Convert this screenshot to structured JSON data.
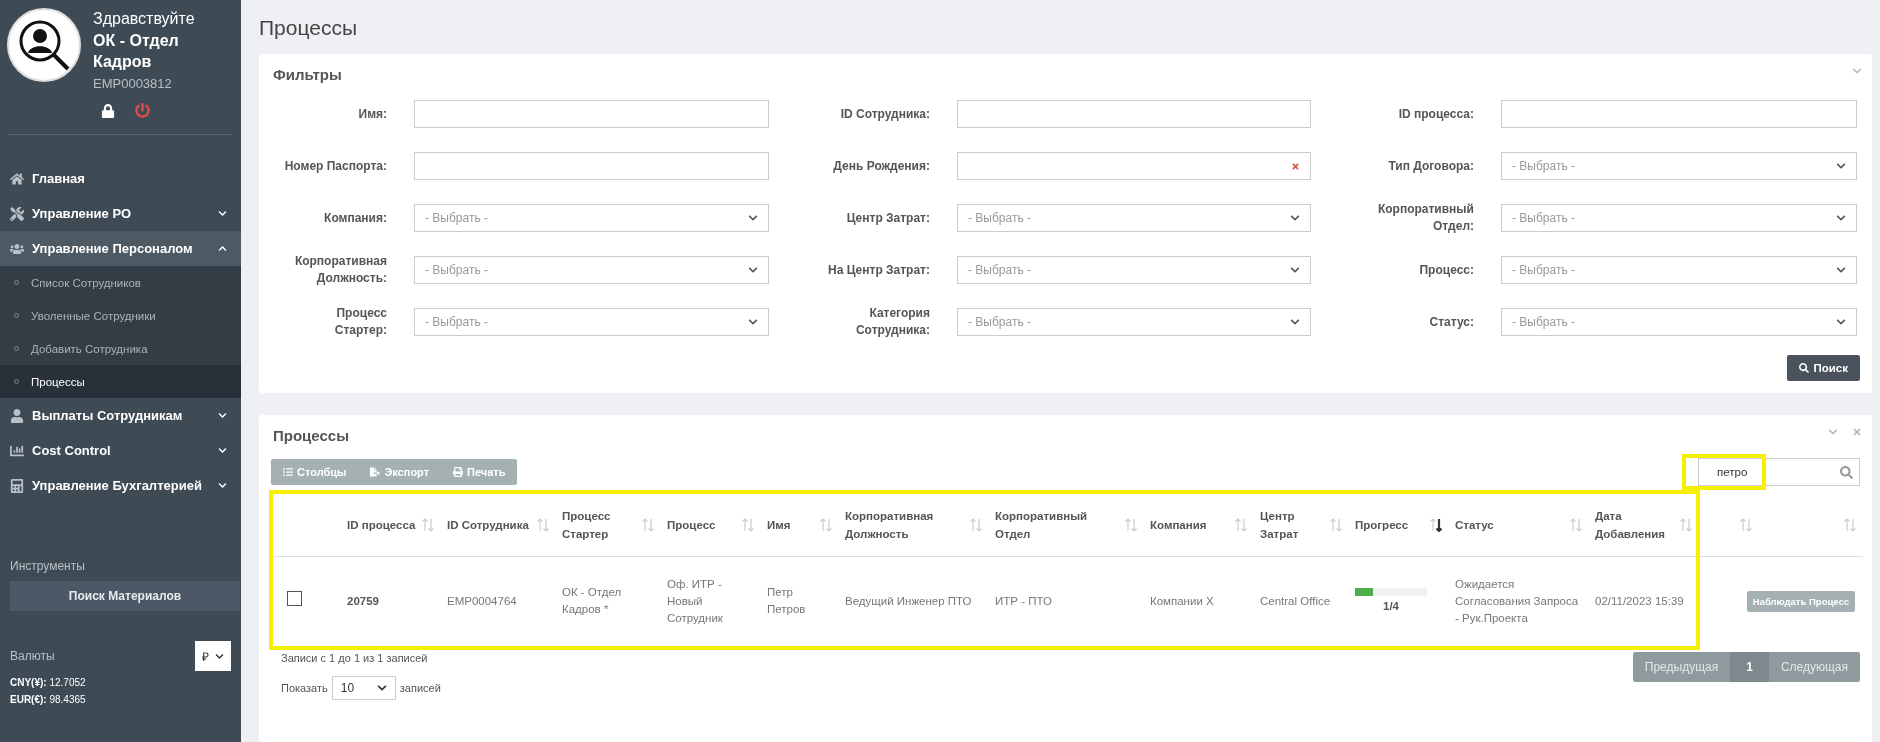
{
  "sidebar": {
    "greeting": "Здравствуйте",
    "user_name": "ОК - Отдел Кадров",
    "employee_id": "EMP0003812",
    "nav": [
      {
        "label": "Главная",
        "kind": "link",
        "selected": false
      },
      {
        "label": "Управление РО",
        "kind": "menu",
        "expanded": false,
        "selected": false
      },
      {
        "label": "Управление Персоналом",
        "kind": "menu",
        "expanded": true,
        "selected": true,
        "children": [
          {
            "label": "Список Сотрудников",
            "selected": false
          },
          {
            "label": "Уволенные Сотрудники",
            "selected": false
          },
          {
            "label": "Добавить Сотрудника",
            "selected": false
          },
          {
            "label": "Процессы",
            "selected": true
          }
        ]
      },
      {
        "label": "Выплаты Сотрудникам",
        "kind": "menu",
        "expanded": false,
        "selected": false
      },
      {
        "label": "Cost Control",
        "kind": "menu",
        "expanded": false,
        "selected": false
      },
      {
        "label": "Управление Бухгалтерией",
        "kind": "menu",
        "expanded": false,
        "selected": false
      }
    ],
    "tools_title": "Инструменты",
    "tools_button": "Поиск Материалов",
    "currency": {
      "label": "Валюты",
      "value": "₽",
      "rates": [
        {
          "code": "CNY(¥):",
          "value": "12.7052"
        },
        {
          "code": "EUR(€):",
          "value": "98.4365"
        }
      ]
    }
  },
  "page_title": "Процессы",
  "filters": {
    "title": "Фильтры",
    "fields": [
      {
        "label": "Имя:",
        "kind": "text"
      },
      {
        "label": "ID Сотрудника:",
        "kind": "text"
      },
      {
        "label": "ID процесса:",
        "kind": "text"
      },
      {
        "label": "Номер Паспорта:",
        "kind": "text"
      },
      {
        "label": "День Рождения:",
        "kind": "date"
      },
      {
        "label": "Тип Договора:",
        "kind": "select",
        "placeholder": "- Выбрать -"
      },
      {
        "label": "Компания:",
        "kind": "select",
        "placeholder": "- Выбрать -"
      },
      {
        "label": "Центр Затрат:",
        "kind": "select",
        "placeholder": "- Выбрать -"
      },
      {
        "label": "Корпоративный Отдел:",
        "kind": "select",
        "placeholder": "- Выбрать -"
      },
      {
        "label": "Корпоративная Должность:",
        "kind": "select",
        "placeholder": "- Выбрать -"
      },
      {
        "label": "На Центр Затрат:",
        "kind": "select",
        "placeholder": "- Выбрать -"
      },
      {
        "label": "Процесс:",
        "kind": "select",
        "placeholder": "- Выбрать -"
      },
      {
        "label": "Процесс Стартер:",
        "kind": "select",
        "placeholder": "- Выбрать -"
      },
      {
        "label": "Категория Сотрудника:",
        "kind": "select",
        "placeholder": "- Выбрать -"
      },
      {
        "label": "Статус:",
        "kind": "select",
        "placeholder": "- Выбрать -"
      }
    ],
    "search_button": "Поиск"
  },
  "processes": {
    "title": "Процессы",
    "toolbar": [
      "Столбцы",
      "Экспорт",
      "Печать"
    ],
    "search_value": "петро",
    "columns": [
      {
        "sortable": false
      },
      {
        "label": "ID процесса",
        "sortable": true,
        "sorted": false
      },
      {
        "label": "ID Сотрудника",
        "sortable": true,
        "sorted": false
      },
      {
        "label": "Процесс Стартер",
        "sortable": true,
        "sorted": false
      },
      {
        "label": "Процесс",
        "sortable": true,
        "sorted": false
      },
      {
        "label": "Имя",
        "sortable": true,
        "sorted": false
      },
      {
        "label": "Корпоративная Должность",
        "sortable": true,
        "sorted": false
      },
      {
        "label": "Корпоративный Отдел",
        "sortable": true,
        "sorted": false
      },
      {
        "label": "Компания",
        "sortable": true,
        "sorted": false
      },
      {
        "label": "Центр Затрат",
        "sortable": true,
        "sorted": false
      },
      {
        "label": "Прогресс",
        "sortable": true,
        "sorted": true
      },
      {
        "label": "Статус",
        "sortable": true,
        "sorted": false
      },
      {
        "label": "Дата Добавления",
        "sortable": true,
        "sorted": false
      },
      {
        "sortable": true,
        "sorted": false
      },
      {
        "sortable": true,
        "sorted": false
      }
    ],
    "rows": [
      {
        "checked": false,
        "process_id": "20759",
        "employee_id": "EMP0004764",
        "starter": "ОК - Отдел Кадров *",
        "process": "Оф. ИТР - Новый Сотрудник",
        "name": "Петр Петров",
        "position": "Ведущий Инженер ПТО",
        "department": "ИТР - ПТО",
        "company": "Компании X",
        "cost_center": "Central Office",
        "progress": {
          "level": 0.25,
          "text": "1/4"
        },
        "status": "Ожидается Согласования Запроса - Рук.Проекта",
        "date": "02/11/2023 15:39",
        "action": "Наблюдать Процесс"
      }
    ],
    "info": "Записи с 1 до 1 из 1 записей",
    "show_label": "Показать",
    "page_size": "10",
    "show_suffix": "записей",
    "pagination": [
      {
        "label": "Предыдущая",
        "kind": "nav",
        "disabled": true,
        "selected": false
      },
      {
        "label": "1",
        "kind": "page",
        "disabled": false,
        "selected": true
      },
      {
        "label": "Следующая",
        "kind": "nav",
        "disabled": true,
        "selected": false
      }
    ]
  }
}
